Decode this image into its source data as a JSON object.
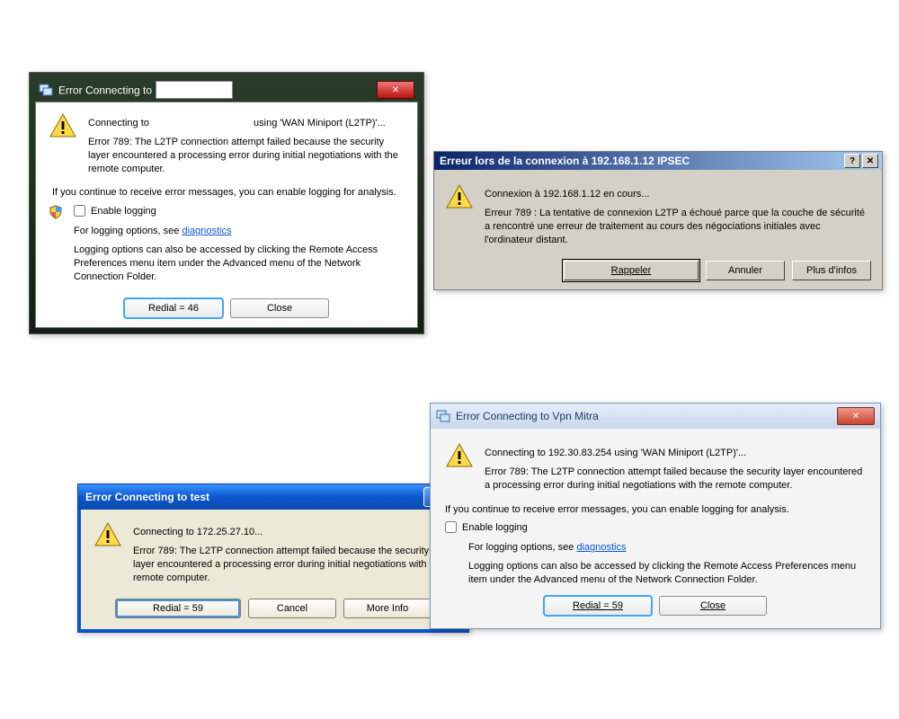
{
  "d1": {
    "title_prefix": "Error Connecting to",
    "conn_left": "Connecting to",
    "conn_right": "using 'WAN Miniport (L2TP)'...",
    "err": "Error 789: The L2TP connection attempt failed because the security layer encountered a processing error during initial negotiations with the remote computer.",
    "cont": "If you continue to receive error messages, you can enable logging for analysis.",
    "enable": "Enable logging",
    "diag_prefix": "For logging options, see ",
    "diag_link": "diagnostics",
    "logopts": "Logging options can also be accessed by clicking the Remote Access Preferences menu item under the Advanced menu of the Network Connection Folder.",
    "redial": "Redial = 46",
    "close": "Close"
  },
  "d2": {
    "title": "Erreur lors de la connexion à 192.168.1.12 IPSEC",
    "conn": "Connexion à 192.168.1.12 en cours...",
    "err": "Erreur 789 : La tentative de connexion L2TP a échoué parce que la couche de sécurité a rencontré une erreur de traitement au cours des négociations initiales avec l'ordinateur distant.",
    "redial": "Rappeler",
    "cancel": "Annuler",
    "more": "Plus d'infos"
  },
  "d3": {
    "title": "Error Connecting to test",
    "conn": "Connecting to 172.25.27.10...",
    "err": "Error 789: The L2TP connection attempt failed because the security layer encountered a processing error during initial negotiations with the remote computer.",
    "redial": "Redial = 59",
    "cancel": "Cancel",
    "more": "More Info"
  },
  "d4": {
    "title": "Error Connecting to Vpn Mitra",
    "conn": "Connecting to 192.30.83.254 using 'WAN Miniport (L2TP)'...",
    "err": "Error 789: The L2TP connection attempt failed because the security layer encountered a processing error during initial negotiations with the remote computer.",
    "cont": "If you continue to receive error messages, you can enable logging for analysis.",
    "enable": "Enable logging",
    "diag_prefix": "For logging options, see ",
    "diag_link": "diagnostics",
    "logopts": "Logging options can also be accessed by clicking the Remote Access Preferences menu item under the Advanced menu of the Network Connection Folder.",
    "redial": "Redial = 59",
    "close": "Close"
  }
}
